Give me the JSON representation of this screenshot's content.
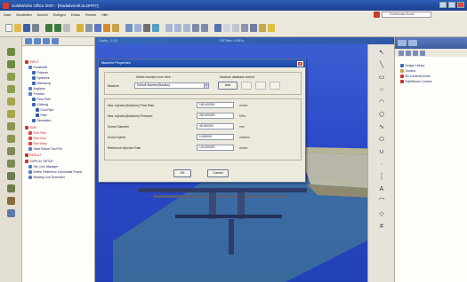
{
  "window": {
    "title": "SolidWorks Office 2007 - [Radialventil.SLDPRT]"
  },
  "menu": {
    "items": [
      "Datei",
      "Bearbeiten",
      "Ansicht",
      "Einfügen",
      "Extras",
      "Fenster",
      "Hilfe"
    ],
    "search_placeholder": "SolidWorks-Suche"
  },
  "viewport": {
    "title": "Cavity - 2 (1)",
    "status": "Fill Time: 0.000 s"
  },
  "tree": {
    "items": [
      {
        "label": "INPUT",
        "indent": 0,
        "red": true
      },
      {
        "label": "Kunststoff",
        "indent": 1,
        "red": false
      },
      {
        "label": "Polymer",
        "indent": 2,
        "red": false
      },
      {
        "label": "Spritzzeit",
        "indent": 2,
        "red": false
      },
      {
        "label": "Werkzeug",
        "indent": 2,
        "red": false
      },
      {
        "label": "Angüsse",
        "indent": 1,
        "red": false
      },
      {
        "label": "Prozess",
        "indent": 1,
        "red": false
      },
      {
        "label": "Flow Path",
        "indent": 2,
        "red": false
      },
      {
        "label": "Kühlung",
        "indent": 2,
        "red": false
      },
      {
        "label": "Cool Pipe",
        "indent": 3,
        "red": false
      },
      {
        "label": "Filter",
        "indent": 3,
        "red": false
      },
      {
        "label": "Simulation",
        "indent": 2,
        "red": false
      },
      {
        "label": "RUN",
        "indent": 0,
        "red": true
      },
      {
        "label": "Run Flow",
        "indent": 1,
        "red": true
      },
      {
        "label": "Run Cool",
        "indent": 1,
        "red": true
      },
      {
        "label": "Run Warp",
        "indent": 1,
        "red": true
      },
      {
        "label": "Save Report Tool File",
        "indent": 1,
        "red": false
      },
      {
        "label": "RESULT",
        "indent": 0,
        "red": true
      },
      {
        "label": "DISPLAY SETUP",
        "indent": 0,
        "red": false
      },
      {
        "label": "Set_Line Manager",
        "indent": 1,
        "red": false
      },
      {
        "label": "Define Reference Coordinate Frame",
        "indent": 1,
        "red": false
      },
      {
        "label": "Molding Line Generator",
        "indent": 1,
        "red": false
      }
    ]
  },
  "taskpane": {
    "items": [
      "Design Library",
      "Toolbox",
      "3D ContentCentral",
      "SolidWorks Content"
    ]
  },
  "dialog": {
    "title": "Machine Properties",
    "select_machine_label": "Select machine from here :",
    "machine_label": "Machine",
    "machine_value": "Default Machine(Nastiku)",
    "database_label": "Machine database control",
    "add_label": "Add",
    "rows": [
      {
        "label": "Max. Injection(Machine) Flow Rate",
        "value": "100.000000",
        "unit": "cc/sec"
      },
      {
        "label": "Max. Injection(Machine) Pressure",
        "value": "250.000000",
        "unit": "MPa"
      },
      {
        "label": "Screw Diameter",
        "value": "45.000000",
        "unit": "mm"
      },
      {
        "label": "Screw Speed",
        "value": "0.000000",
        "unit": "mm/sec"
      },
      {
        "label": "Reference Injection Rate",
        "value": "120.000000",
        "unit": "cc/sec"
      }
    ],
    "ok_label": "OK",
    "cancel_label": "Cancel"
  },
  "colors": {
    "viewport_bg": "#2b49c8",
    "title_bar": "#1c3f8f",
    "dialog_bg": "#ece9dd",
    "tree_red": "#cc2222"
  }
}
